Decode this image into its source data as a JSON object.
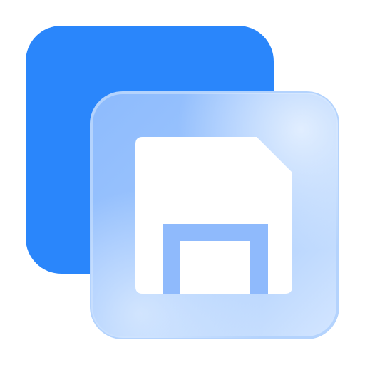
{
  "icon": {
    "name": "save-file-icon",
    "colors": {
      "back_square": "#2a86fb",
      "front_tile_light": "#d6e8ff",
      "front_tile_mid": "#8fbcfd",
      "front_tile_edge": "#b7d5fd",
      "glyph": "#ffffff"
    }
  }
}
